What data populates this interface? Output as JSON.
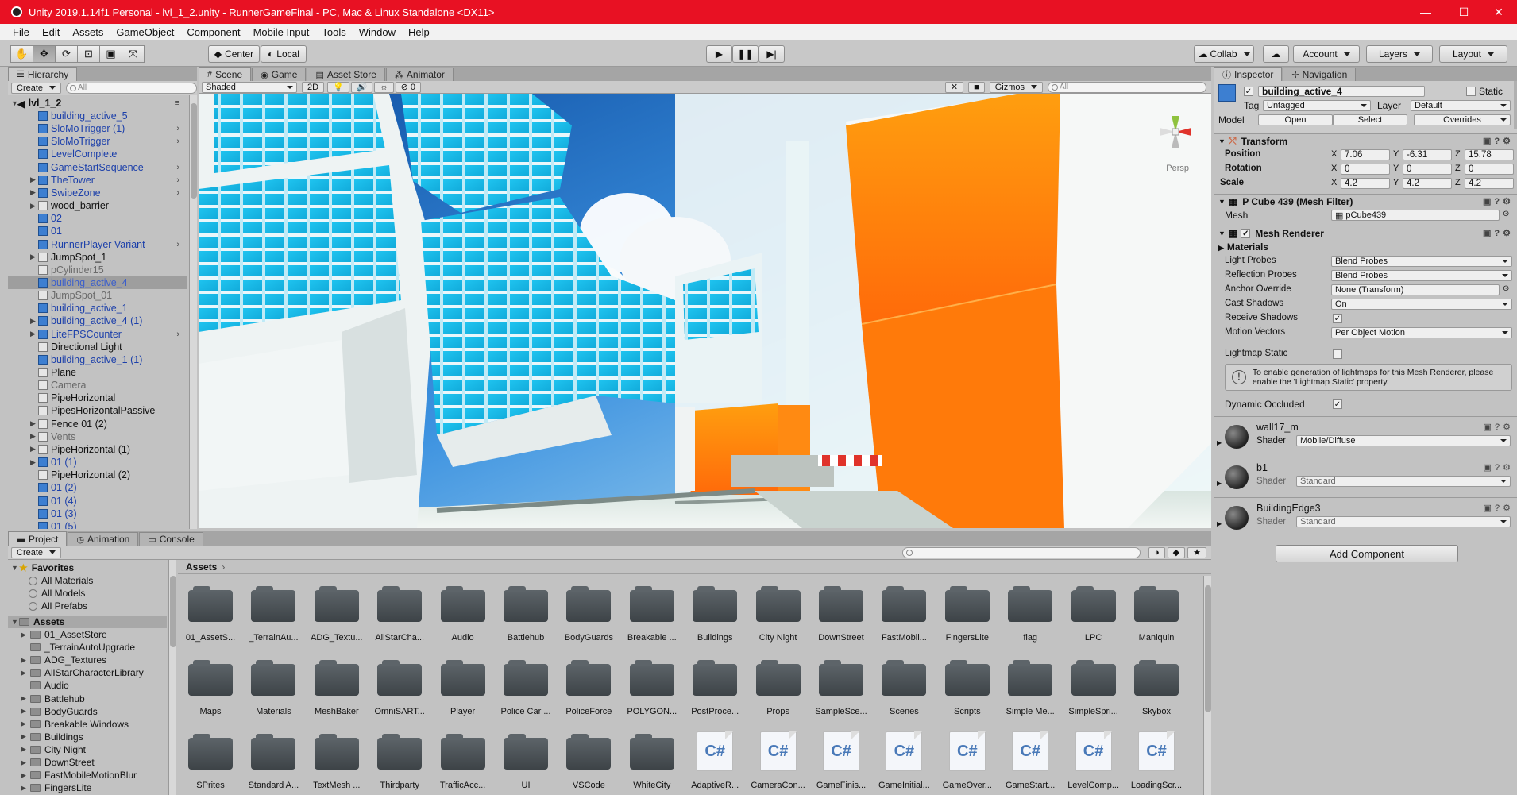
{
  "window": {
    "title": "Unity 2019.1.14f1 Personal - lvl_1_2.unity - RunnerGameFinal - PC, Mac & Linux Standalone <DX11>",
    "minimize": "—",
    "maximize": "☐",
    "close": "✕"
  },
  "menu": [
    "File",
    "Edit",
    "Assets",
    "GameObject",
    "Component",
    "Mobile Input",
    "Tools",
    "Window",
    "Help"
  ],
  "toolbar": {
    "center_label": "Center",
    "local_label": "Local",
    "collab_label": "Collab",
    "account_label": "Account",
    "layers_label": "Layers",
    "layout_label": "Layout"
  },
  "hierarchy": {
    "tab": "Hierarchy",
    "create": "Create",
    "search_placeholder": "All",
    "scene_name": "lvl_1_2",
    "items": [
      {
        "label": "building_active_5",
        "style": "prefab"
      },
      {
        "label": "SloMoTrigger (1)",
        "style": "prefab"
      },
      {
        "label": "SloMoTrigger",
        "style": "prefab"
      },
      {
        "label": "LevelComplete",
        "style": "prefab"
      },
      {
        "label": "GameStartSequence",
        "style": "prefab"
      },
      {
        "label": "TheTower",
        "style": "prefab"
      },
      {
        "label": "SwipeZone",
        "style": "prefab"
      },
      {
        "label": "wood_barrier",
        "style": "normal"
      },
      {
        "label": "02",
        "style": "prefab"
      },
      {
        "label": "01",
        "style": "prefab"
      },
      {
        "label": "RunnerPlayer Variant",
        "style": "prefab"
      },
      {
        "label": "JumpSpot_1",
        "style": "normal"
      },
      {
        "label": "pCylinder15",
        "style": "dim"
      },
      {
        "label": "building_active_4",
        "style": "selected"
      },
      {
        "label": "JumpSpot_01",
        "style": "dim"
      },
      {
        "label": "building_active_1",
        "style": "prefab"
      },
      {
        "label": "building_active_4 (1)",
        "style": "prefab"
      },
      {
        "label": "LiteFPSCounter",
        "style": "prefab"
      },
      {
        "label": "Directional Light",
        "style": "normal"
      },
      {
        "label": "building_active_1 (1)",
        "style": "prefab"
      },
      {
        "label": "Plane",
        "style": "normal"
      },
      {
        "label": "Camera",
        "style": "dim"
      },
      {
        "label": "PipeHorizontal",
        "style": "normal"
      },
      {
        "label": "PipesHorizontalPassive",
        "style": "normal"
      },
      {
        "label": "Fence 01 (2)",
        "style": "normal"
      },
      {
        "label": "Vents",
        "style": "dim"
      },
      {
        "label": "PipeHorizontal (1)",
        "style": "normal"
      },
      {
        "label": "01 (1)",
        "style": "prefab"
      },
      {
        "label": "PipeHorizontal (2)",
        "style": "normal"
      },
      {
        "label": "01 (2)",
        "style": "prefab"
      },
      {
        "label": "01 (4)",
        "style": "prefab"
      },
      {
        "label": "01 (3)",
        "style": "prefab"
      },
      {
        "label": "01 (5)",
        "style": "prefab"
      }
    ]
  },
  "scene": {
    "tabs": [
      "Scene",
      "Game",
      "Asset Store",
      "Animator"
    ],
    "shading": "Shaded",
    "mode_2d": "2D",
    "fx_count": "0",
    "gizmos": "Gizmos",
    "search_placeholder": "All",
    "persp": "Persp"
  },
  "project": {
    "tabs": [
      "Project",
      "Animation",
      "Console"
    ],
    "create": "Create",
    "breadcrumb": "Assets",
    "favorites_label": "Favorites",
    "favorites": [
      "All Materials",
      "All Models",
      "All Prefabs"
    ],
    "assets_label": "Assets",
    "tree": [
      "01_AssetStore",
      "_TerrainAutoUpgrade",
      "ADG_Textures",
      "AllStarCharacterLibrary",
      "Audio",
      "Battlehub",
      "BodyGuards",
      "Breakable Windows",
      "Buildings",
      "City Night",
      "DownStreet",
      "FastMobileMotionBlur",
      "FingersLite"
    ],
    "grid": [
      {
        "label": "01_AssetS...",
        "type": "folder"
      },
      {
        "label": "_TerrainAu...",
        "type": "folder"
      },
      {
        "label": "ADG_Textu...",
        "type": "folder"
      },
      {
        "label": "AllStarCha...",
        "type": "folder"
      },
      {
        "label": "Audio",
        "type": "folder"
      },
      {
        "label": "Battlehub",
        "type": "folder"
      },
      {
        "label": "BodyGuards",
        "type": "folder"
      },
      {
        "label": "Breakable ...",
        "type": "folder"
      },
      {
        "label": "Buildings",
        "type": "folder"
      },
      {
        "label": "City Night",
        "type": "folder"
      },
      {
        "label": "DownStreet",
        "type": "folder"
      },
      {
        "label": "FastMobil...",
        "type": "folder"
      },
      {
        "label": "FingersLite",
        "type": "folder"
      },
      {
        "label": "flag",
        "type": "folder"
      },
      {
        "label": "LPC",
        "type": "folder"
      },
      {
        "label": "Maniquin",
        "type": "folder"
      },
      {
        "label": "Maps",
        "type": "folder"
      },
      {
        "label": "Materials",
        "type": "folder"
      },
      {
        "label": "MeshBaker",
        "type": "folder"
      },
      {
        "label": "OmniSART...",
        "type": "folder"
      },
      {
        "label": "Player",
        "type": "folder"
      },
      {
        "label": "Police Car ...",
        "type": "folder"
      },
      {
        "label": "PoliceForce",
        "type": "folder"
      },
      {
        "label": "POLYGON...",
        "type": "folder"
      },
      {
        "label": "PostProce...",
        "type": "folder"
      },
      {
        "label": "Props",
        "type": "folder"
      },
      {
        "label": "SampleSce...",
        "type": "folder"
      },
      {
        "label": "Scenes",
        "type": "folder"
      },
      {
        "label": "Scripts",
        "type": "folder"
      },
      {
        "label": "Simple Me...",
        "type": "folder"
      },
      {
        "label": "SimpleSpri...",
        "type": "folder"
      },
      {
        "label": "Skybox",
        "type": "folder"
      },
      {
        "label": "SPrites",
        "type": "folder"
      },
      {
        "label": "Standard A...",
        "type": "folder"
      },
      {
        "label": "TextMesh ...",
        "type": "folder"
      },
      {
        "label": "Thirdparty",
        "type": "folder"
      },
      {
        "label": "TrafficAcc...",
        "type": "folder"
      },
      {
        "label": "UI",
        "type": "folder"
      },
      {
        "label": "VSCode",
        "type": "folder"
      },
      {
        "label": "WhiteCity",
        "type": "folder"
      },
      {
        "label": "AdaptiveR...",
        "type": "script"
      },
      {
        "label": "CameraCon...",
        "type": "script"
      },
      {
        "label": "GameFinis...",
        "type": "script"
      },
      {
        "label": "GameInitial...",
        "type": "script"
      },
      {
        "label": "GameOver...",
        "type": "script"
      },
      {
        "label": "GameStart...",
        "type": "script"
      },
      {
        "label": "LevelComp...",
        "type": "script"
      },
      {
        "label": "LoadingScr...",
        "type": "script"
      }
    ],
    "cs_glyph": "C#"
  },
  "inspector": {
    "tabs": [
      "Inspector",
      "Navigation"
    ],
    "object_name": "building_active_4",
    "static_label": "Static",
    "tag_label": "Tag",
    "tag_value": "Untagged",
    "layer_label": "Layer",
    "layer_value": "Default",
    "model_label": "Model",
    "open_btn": "Open",
    "select_btn": "Select",
    "overrides_btn": "Overrides",
    "transform": {
      "title": "Transform",
      "position_label": "Position",
      "rotation_label": "Rotation",
      "scale_label": "Scale",
      "axis_x": "X",
      "axis_y": "Y",
      "axis_z": "Z",
      "position": {
        "x": "7.06",
        "y": "-6.31",
        "z": "15.78"
      },
      "rotation": {
        "x": "0",
        "y": "0",
        "z": "0"
      },
      "scale": {
        "x": "4.2",
        "y": "4.2",
        "z": "4.2"
      }
    },
    "mesh_filter": {
      "title": "P Cube 439 (Mesh Filter)",
      "mesh_label": "Mesh",
      "mesh_value": "pCube439"
    },
    "mesh_renderer": {
      "title": "Mesh Renderer",
      "materials_label": "Materials",
      "light_probes_label": "Light Probes",
      "light_probes_value": "Blend Probes",
      "reflection_probes_label": "Reflection Probes",
      "reflection_probes_value": "Blend Probes",
      "anchor_override_label": "Anchor Override",
      "anchor_override_value": "None (Transform)",
      "cast_shadows_label": "Cast Shadows",
      "cast_shadows_value": "On",
      "receive_shadows_label": "Receive Shadows",
      "motion_vectors_label": "Motion Vectors",
      "motion_vectors_value": "Per Object Motion",
      "lightmap_static_label": "Lightmap Static",
      "info_text": "To enable generation of lightmaps for this Mesh Renderer, please enable the 'Lightmap Static' property.",
      "dynamic_occluded_label": "Dynamic Occluded"
    },
    "materials": [
      {
        "name": "wall17_m",
        "shader_label": "Shader",
        "shader": "Mobile/Diffuse"
      },
      {
        "name": "b1",
        "shader_label": "Shader",
        "shader": "Standard"
      },
      {
        "name": "BuildingEdge3",
        "shader_label": "Shader",
        "shader": "Standard"
      }
    ],
    "add_component": "Add Component"
  },
  "colors": {
    "titlebar": "#e81123",
    "editor_bg": "#c2c2c2",
    "prefab_text": "#1b3faa",
    "orange": "#ff7a0a",
    "sky": "#2f86d8"
  }
}
